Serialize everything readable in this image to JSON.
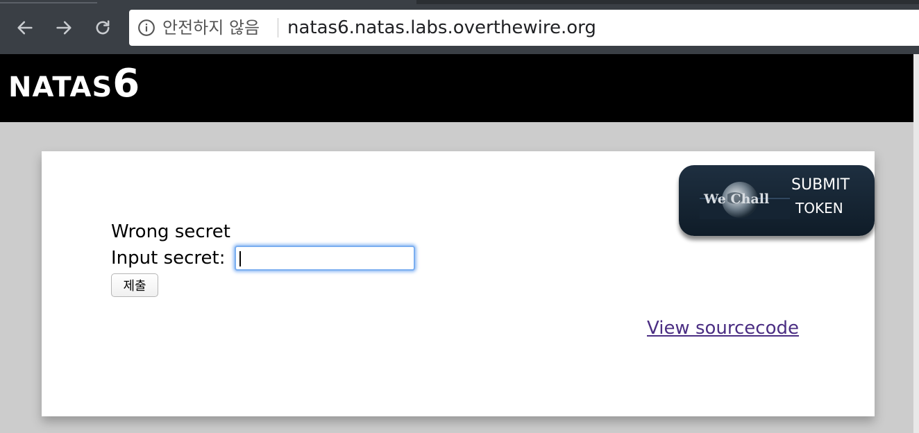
{
  "browser": {
    "security_label": "안전하지 않음",
    "url": "natas6.natas.labs.overthewire.org",
    "back_icon": "arrow-left-icon",
    "forward_icon": "arrow-right-icon",
    "reload_icon": "reload-icon",
    "info_icon": "info-icon"
  },
  "banner": {
    "title_word": "NATAS",
    "title_number": "6"
  },
  "wechall": {
    "logo_text": "We Chall",
    "line1": "SUBMIT",
    "line2": "TOKEN"
  },
  "form": {
    "message": "Wrong secret",
    "input_label": "Input secret:",
    "input_value": "",
    "submit_label": "제출"
  },
  "links": {
    "view_source": "View sourcecode"
  },
  "colors": {
    "chrome_bg": "#3a3f45",
    "banner_bg": "#000000",
    "page_bg": "#cccccc",
    "link": "#4b2e83",
    "focus_ring": "#7aaef0"
  }
}
